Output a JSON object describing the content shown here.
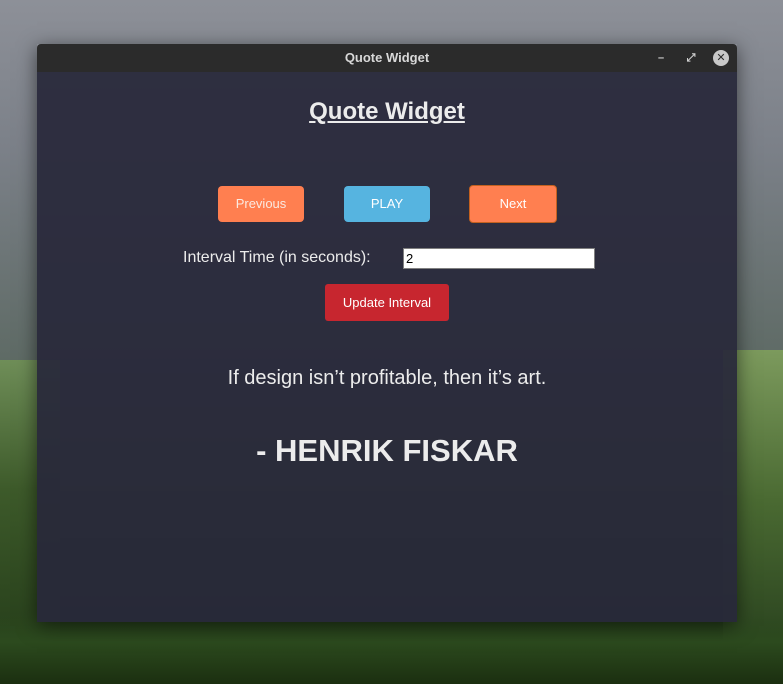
{
  "window": {
    "title": "Quote Widget",
    "minimize_glyph": "–",
    "maximize_glyph": "⤢",
    "close_glyph": "✕"
  },
  "widget": {
    "heading": "Quote Widget",
    "buttons": {
      "previous": "Previous",
      "play": "PLAY",
      "next": "Next"
    },
    "interval": {
      "label": "Interval Time (in seconds):",
      "value": "2"
    },
    "update_button": "Update Interval",
    "quote": {
      "text": "If design isn’t profitable, then it’s art.",
      "author": "- HENRIK FISKAR"
    }
  },
  "colors": {
    "prev_button": "#ff7f50",
    "play_button": "#56b4e0",
    "next_button": "#ff7f50",
    "update_button": "#c7262f",
    "panel_bg": "#28283a",
    "titlebar_bg": "#2b2b2b"
  }
}
